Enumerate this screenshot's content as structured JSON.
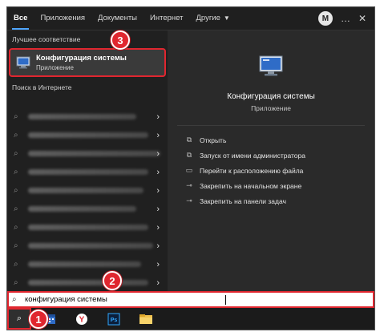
{
  "tabs": [
    {
      "label": "Все"
    },
    {
      "label": "Приложения"
    },
    {
      "label": "Документы"
    },
    {
      "label": "Интернет"
    },
    {
      "label": "Другие"
    }
  ],
  "header": {
    "avatar_letter": "M",
    "more_icon": "…",
    "close_icon": "✕"
  },
  "left": {
    "best_match_title": "Лучшее соответствие",
    "best_match": {
      "name": "Конфигурация системы",
      "kind": "Приложение"
    },
    "web_title": "Поиск в Интернете",
    "web_rows": [
      {
        "width": 0.45
      },
      {
        "width": 0.5
      },
      {
        "width": 0.55
      },
      {
        "width": 0.5
      },
      {
        "width": 0.48
      },
      {
        "width": 0.45
      },
      {
        "width": 0.5
      },
      {
        "width": 0.52
      },
      {
        "width": 0.47
      },
      {
        "width": 0.5
      }
    ]
  },
  "right": {
    "title": "Конфигурация системы",
    "subtitle": "Приложение",
    "actions": [
      {
        "label": "Открыть",
        "icon": "open-icon"
      },
      {
        "label": "Запуск от имени администратора",
        "icon": "admin-icon"
      },
      {
        "label": "Перейти к расположению файла",
        "icon": "folder-icon"
      },
      {
        "label": "Закрепить на начальном экране",
        "icon": "pin-icon"
      },
      {
        "label": "Закрепить на панели задач",
        "icon": "pin-icon"
      }
    ]
  },
  "search": {
    "value": "конфигурация системы"
  },
  "callouts": {
    "one": "1",
    "two": "2",
    "three": "3"
  },
  "colors": {
    "accent": "#e0262f",
    "tab_underline": "#4ea5ff"
  }
}
